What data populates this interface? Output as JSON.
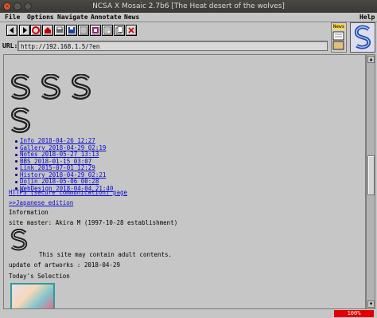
{
  "window": {
    "title": "NCSA X Mosaic 2.7b6 [The Heat desert of the wolves]"
  },
  "menu": {
    "file": "File",
    "options": "Options",
    "navigate": "Navigate",
    "annotate": "Annotate",
    "news": "News",
    "help": "Help"
  },
  "toolbar": {
    "icons": [
      "back-icon",
      "forward-icon",
      "reload-icon",
      "home-icon",
      "print-icon",
      "save-icon",
      "hotlist-icon",
      "clone-window-icon",
      "newspaper-icon",
      "copy-icon",
      "close-icon"
    ],
    "news_button": "News"
  },
  "url": {
    "label": "URL:",
    "value": "http://192.168.1.5/?en"
  },
  "page": {
    "links": [
      "Info 2018-04-26 12:27",
      "Gallery 2018-04-29 02:19",
      "Notes 2018-05-27 13:13",
      "BBS 2018-01-15 03:07",
      "Link 2015-07-01 12:29",
      "History 2018-04-29 02:21",
      "Dojin 2018-05-06 00:28",
      "WebDesign 2018-04-04 21:40"
    ],
    "https_link": "HTTPS (secure communication) page",
    "japanese_link": ">>Japanese edition",
    "information": "Information",
    "site_master": "site master: Akira M (1997-10-28 establishment)",
    "adult_notice": "This site may contain adult contents.",
    "update": "update of artworks : 2018-04-29",
    "selection": "Today's Selection"
  },
  "status": {
    "progress_text": "100%",
    "progress_value": 100,
    "progress_color": "#e30000"
  }
}
